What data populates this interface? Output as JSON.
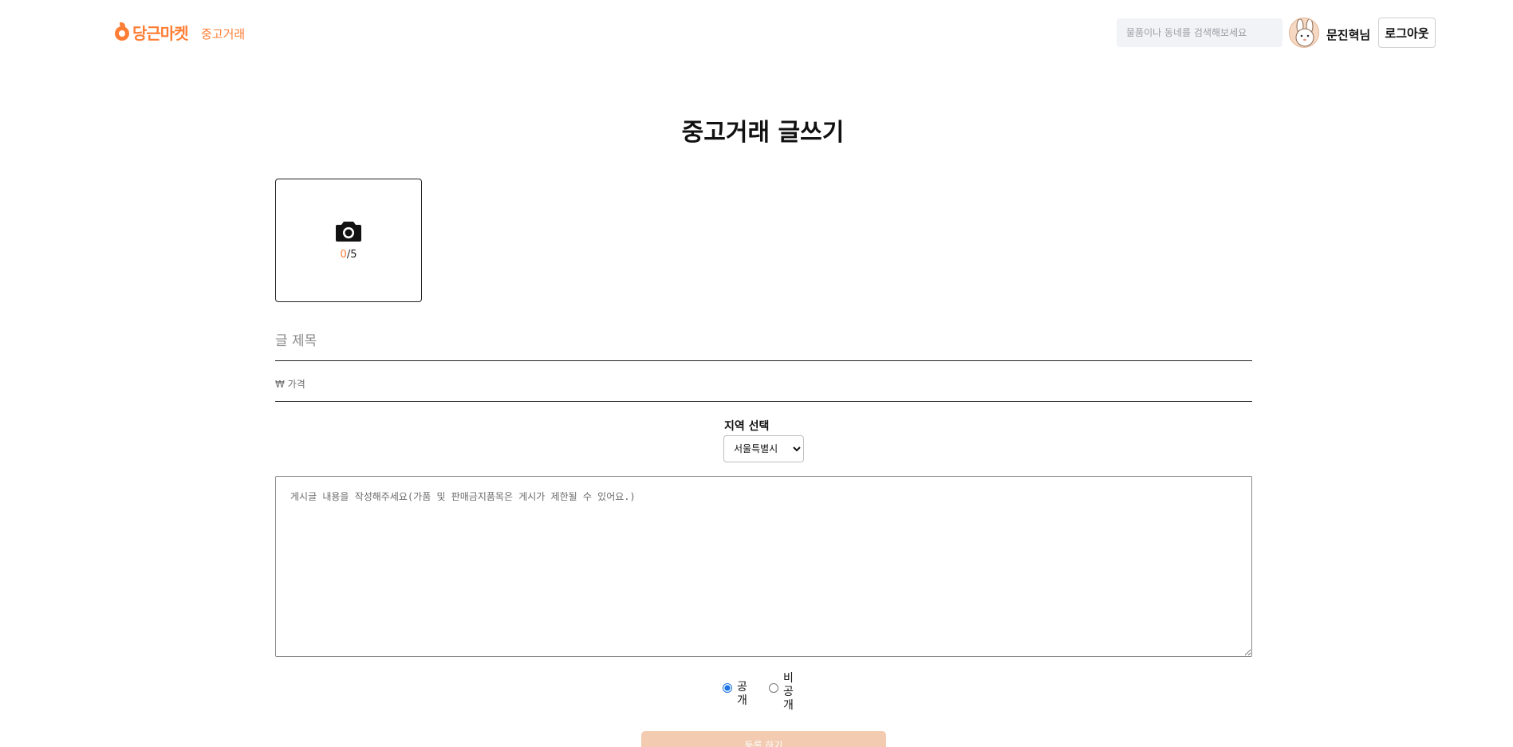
{
  "header": {
    "logo_text": "당근마켓",
    "nav_label": "중고거래",
    "search_placeholder": "물품이나 동네를 검색해보세요",
    "username": "문진혁님",
    "logout_label": "로그아웃"
  },
  "form": {
    "page_title": "중고거래 글쓰기",
    "photo_count_current": "0",
    "photo_count_max": "/5",
    "title_placeholder": "글 제목",
    "price_placeholder": "₩ 가격",
    "region_label": "지역 선택",
    "region_selected": "서울특별시",
    "content_placeholder": "게시글 내용을 작성해주세요(가품 및 판매금지품목은 게시가 제한될 수 있어요.)",
    "visibility": {
      "public_label": "공개",
      "private_label": "비공개",
      "selected": "public"
    },
    "submit_label": "등록 하기"
  },
  "colors": {
    "brand": "#ff7e36",
    "submit_disabled": "#f2cbb0"
  }
}
